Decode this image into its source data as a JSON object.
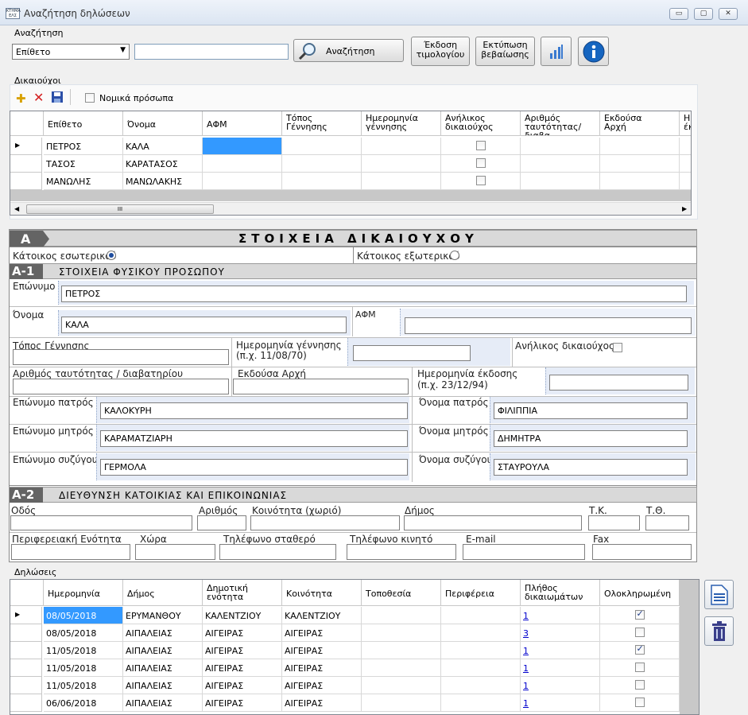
{
  "window": {
    "title": "Αναζήτηση δηλώσεων",
    "app_icon_text": "ΚΤΗΜΑ ΕΛΣ",
    "min": "▭",
    "max": "▢",
    "close": "✕"
  },
  "search": {
    "group_label": "Αναζήτηση",
    "select_value": "Επίθετο",
    "input_value": "",
    "button_label": "Αναζήτηση",
    "invoice_button": "Έκδοση\nτιμολογίου",
    "cert_button": "Εκτύπωση\nβεβαίωσης"
  },
  "beneficiaries": {
    "group_label": "Δικαιούχοι",
    "legal_entities_label": "Νομικά πρόσωπα",
    "columns": [
      "Επίθετο",
      "Όνομα",
      "ΑΦΜ",
      "Τόπος\nΓέννησης",
      "Ημερομηνία\nγέννησης",
      "Ανήλικος\nδικαιούχος",
      "Αριθμός\nταυτότητας/διαβα",
      "Εκδούσα\nΑρχή",
      "Η\nέκ"
    ],
    "rows": [
      {
        "surname": "ΠΕΤΡΟΣ",
        "name": "ΚΑΛΑ"
      },
      {
        "surname": "ΤΑΣΟΣ",
        "name": "ΚΑΡΑΤΑΣΟΣ"
      },
      {
        "surname": "ΜΑΝΩΛΗΣ",
        "name": "ΜΑΝΩΛΑΚΗΣ"
      }
    ],
    "scroll_thumb": "III"
  },
  "sectionA": {
    "letter": "A",
    "title": "ΣΤΟΙΧΕΙΑ ΔΙΚΑΙΟΥΧΟΥ",
    "resident_inside": "Κάτοικος εσωτερικού",
    "resident_outside": "Κάτοικος εξωτερικού"
  },
  "sectionA1": {
    "letter": "A-1",
    "title": "ΣΤΟΙΧΕΙΑ ΦΥΣΙΚΟΥ ΠΡΟΣΩΠΟΥ",
    "surname_label": "Επώνυμο",
    "surname": "ΠΕΤΡΟΣ",
    "name_label": "Όνομα",
    "name": "ΚΑΛΑ",
    "afm_label": "ΑΦΜ",
    "birthplace_label": "Τόπος Γέννησης",
    "birthdate_label": "Ημερομηνία γέννησης\n(π.χ. 11/08/70)",
    "minor_label": "Ανήλικος δικαιούχος",
    "id_label": "Αριθμός ταυτότητας / διαβατηρίου",
    "authority_label": "Εκδούσα Αρχή",
    "issue_label": "Ημερομηνία έκδοσης\n(π.χ. 23/12/94)",
    "father_surname_label": "Επώνυμο πατρός",
    "father_surname": "ΚΑΛΟΚΥΡΗ",
    "father_name_label": "Όνομα πατρός",
    "father_name": "ΦΙΛΙΠΠΙΑ",
    "mother_surname_label": "Επώνυμο μητρός",
    "mother_surname": "ΚΑΡΑΜΑΤΖΙΑΡΗ",
    "mother_name_label": "Όνομα μητρός",
    "mother_name": "ΔΗΜΗΤΡΑ",
    "spouse_surname_label": "Επώνυμο συζύγου",
    "spouse_surname": "ΓΕΡΜΟΛΑ",
    "spouse_name_label": "Όνομα συζύγου",
    "spouse_name": "ΣΤΑΥΡΟΥΛΑ"
  },
  "sectionA2": {
    "letter": "A-2",
    "title": "ΔΙΕΥΘΥΝΣΗ ΚΑΤΟΙΚΙΑΣ ΚΑΙ ΕΠΙΚΟΙΝΩΝΙΑΣ",
    "street": "Οδός",
    "number": "Αριθμός",
    "community": "Κοινότητα (χωριό)",
    "municipality": "Δήμος",
    "tk": "Τ.Κ.",
    "po": "Τ.Θ.",
    "region": "Περιφερειακή Ενότητα",
    "country": "Χώρα",
    "phone": "Τηλέφωνο σταθερό",
    "mobile": "Τηλέφωνο κινητό",
    "email": "E-mail",
    "fax": "Fax"
  },
  "declarations": {
    "group_label": "Δηλώσεις",
    "columns": [
      "Ημερομηνία",
      "Δήμος",
      "Δημοτική\nενότητα",
      "Κοινότητα",
      "Τοποθεσία",
      "Περιφέρεια",
      "Πλήθος\nδικαιωμάτων",
      "Ολοκληρωμένη"
    ],
    "rows": [
      {
        "date": "08/05/2018",
        "municipality": "ΕΡΥΜΑΝΘΟΥ",
        "unit": "ΚΑΛΕΝΤΖΙΟΥ",
        "community": "ΚΑΛΕΝΤΖΙΟΥ",
        "count": "1",
        "done": true
      },
      {
        "date": "08/05/2018",
        "municipality": "ΑΙΠΑΛΕΙΑΣ",
        "unit": "ΑΙΓΕΙΡΑΣ",
        "community": "ΑΙΓΕΙΡΑΣ",
        "count": "3",
        "done": false
      },
      {
        "date": "11/05/2018",
        "municipality": "ΑΙΠΑΛΕΙΑΣ",
        "unit": "ΑΙΓΕΙΡΑΣ",
        "community": "ΑΙΓΕΙΡΑΣ",
        "count": "1",
        "done": true
      },
      {
        "date": "11/05/2018",
        "municipality": "ΑΙΠΑΛΕΙΑΣ",
        "unit": "ΑΙΓΕΙΡΑΣ",
        "community": "ΑΙΓΕΙΡΑΣ",
        "count": "1",
        "done": false
      },
      {
        "date": "11/05/2018",
        "municipality": "ΑΙΠΑΛΕΙΑΣ",
        "unit": "ΑΙΓΕΙΡΑΣ",
        "community": "ΑΙΓΕΙΡΑΣ",
        "count": "1",
        "done": false
      },
      {
        "date": "06/06/2018",
        "municipality": "ΑΙΠΑΛΕΙΑΣ",
        "unit": "ΑΙΓΕΙΡΑΣ",
        "community": "ΑΙΓΕΙΡΑΣ",
        "count": "1",
        "done": false
      }
    ]
  },
  "colors": {
    "accent_selected": "#3399ff",
    "section_header": "#d9d9d9",
    "section_letter": "#646464",
    "link": "#0000cc",
    "info_blue": "#1565c0"
  }
}
